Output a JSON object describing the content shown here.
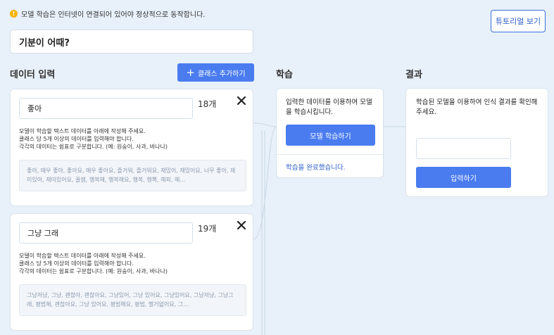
{
  "notice": {
    "icon": "warning-icon",
    "text": "모델 학습은 인터넷이 연결되어 있어야 정상적으로 동작합니다."
  },
  "tutorial_label": "튜토리얼 보기",
  "prompt_text": "기분이 어때?",
  "columns": {
    "data_input": "데이터 입력",
    "train": "학습",
    "result": "결과"
  },
  "add_class_label": "클래스 추가하기",
  "classes": [
    {
      "name": "좋아",
      "count": "18개",
      "help": [
        "모델이 학습할 텍스트 데이터를 아래에 작성해 주세요.",
        "클래스 당 5개 이상의 데이터를 입력해야 합니다.",
        "각각의 데이터는 쉼표로 구분합니다. (예: 원숭이, 사과, 바나나)"
      ],
      "data": "좋아, 매우 좋아, 좋아요, 매우 좋아요, 즐거워, 즐거워요, 재밌어, 재밌어요, 너무 좋아, 재미있어, 재미있어요, 꿀잼, 행복해, 행복해요, 행복, 행뽁, 해피, 해…"
    },
    {
      "name": "그냥 그래",
      "count": "19개",
      "help": [
        "모델이 학습할 텍스트 데이터를 아래에 작성해 주세요.",
        "클래스 당 5개 이상의 데이터를 입력해야 합니다.",
        "각각의 데이터는 쉼표로 구분합니다. (예: 원숭이, 사과, 바나나)"
      ],
      "data": "그냥저냥, 그냥, 괜찮아, 괜찮아요, 그냥있어, 그냥 있어요, 그냥있어요, 그냥저냥, 그냥그래, 평범해, 괜찮아요, 그냥 있어요, 평범해요, 평범, 별거없어요, 그…"
    }
  ],
  "train": {
    "description": "입력한 데이터를 이용하여 모델을 학습시킵니다.",
    "button": "모델 학습하기",
    "status": "학습을 완료했습니다."
  },
  "result": {
    "description": "학습된 모델을 이용하여 인식 결과를 확인해주세요.",
    "input_value": "",
    "button": "입력하기"
  },
  "colors": {
    "accent": "#4a7cf0",
    "background": "#e8f1fa",
    "warning": "#f4b400"
  }
}
